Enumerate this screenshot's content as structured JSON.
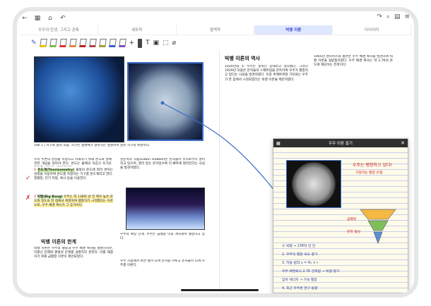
{
  "tabs": [
    "우주의 탄생, 그리고 관측",
    "세포학",
    "열역학",
    "빅뱅 이론",
    "다이어리"
  ],
  "page_nav": [
    "<",
    ">"
  ],
  "zoom_mark": "5",
  "left_page": {
    "caption": "자료 1 | 지구와 달의 모습. 지구는 생명체가 살아가는 행성이며 달은 지구의 위성이다.",
    "body_a": "우리 주변의 현상을 측정하고 이해하기 위해 온도와 열에 관한 개념을 알아야 한다. 온도는 물체의 차갑고 뜨거운 정도를 나타내는 물리량이다.",
    "item1_num": "1",
    "item1_title": "온도계(Thermometry)",
    "item1_text": "물질의 온도에 따라 변하는 성질을 이용하여 온도를 측정하는 기구를 온도계라고 한다. 열팽창, 전기 저항, 복사 등을 이용한다.",
    "item2_num": "2",
    "item2_title": "빅뱅(Big Bang)",
    "item2_text": "우주는 약 138억 년 전 매우 높은 온도와 밀도의 한 점에서 폭발하여 팽창하기 시작했다는 이론으로, 우주 배경 복사가 그 증거이다.",
    "section_title": "빅뱅 이론의 한계",
    "section_text": "빅뱅 이론은 우주의 팽창과 우주 배경 복사를 설명하지만, 지평선 문제와 편평성 문제를 설명하지 못한다. 이를 해결하기 위해 급팽창 이론이 제안되었다.",
    "side_text": "천문학자 허블(Edwin Hubble)은 은하들이 우리로부터 멀어지고 있으며, 멀리 있는 은하일수록 더 빠르게 멀어진다는 사실을 발견하였다.",
    "figure_caption": "우주의 확장 단계. 우주는 급팽창 이후 계속해서 팽창하고 있다.",
    "bottom_text": "우주 시점에서 보면 별이 모여 은하를 이루고 은하들이 모여 우주를 이룬다."
  },
  "right_page": {
    "heading": "빅뱅 이론의 역사",
    "body": "1920년대 초 우주는 정적인 상태라고 생각했다. 그러나 1929년 허블은 은하들의 스펙트럼을 관측하여 우주가 팽창하고 있다는 사실을 발견하였다. 이후 르메트르와 가모프는 우주가 한 점에서 시작되었다는 빅뱅 이론을 제안하였다.",
    "col2": "1965년 펜지어스와 윌슨은 우주 배경 복사를 발견하여 빅뱅 이론을 뒷받침하였다. 우주 배경 복사는 약 2.7K의 온도에 해당하는 전파이다."
  },
  "popup": {
    "title": "우주 이론 필기",
    "note_big": "우주는 팽창하고 있다!",
    "note_sub": "가정하는 팽창 모형",
    "lines": [
      "① 빅뱅 → 138억 년 전",
      "2. 우주의 팽창 속도 증가",
      "3. 허블 법칙 v = H₀ × r",
      "우주 배경복사 2.7K 관측됨 → 빅뱅 증거",
      "암흑 에너지 → 가속 팽창",
      "4. 최근 우주론 연구 동향"
    ],
    "label_a": "급팽창",
    "label_b": "은하 형성"
  },
  "colors": {
    "accent": "#3b4fd6",
    "highlight_green": "#d3f3b0",
    "highlight_yellow": "#fff2a6",
    "ink_red": "#c82020",
    "ink_blue": "#2d3fa0"
  }
}
